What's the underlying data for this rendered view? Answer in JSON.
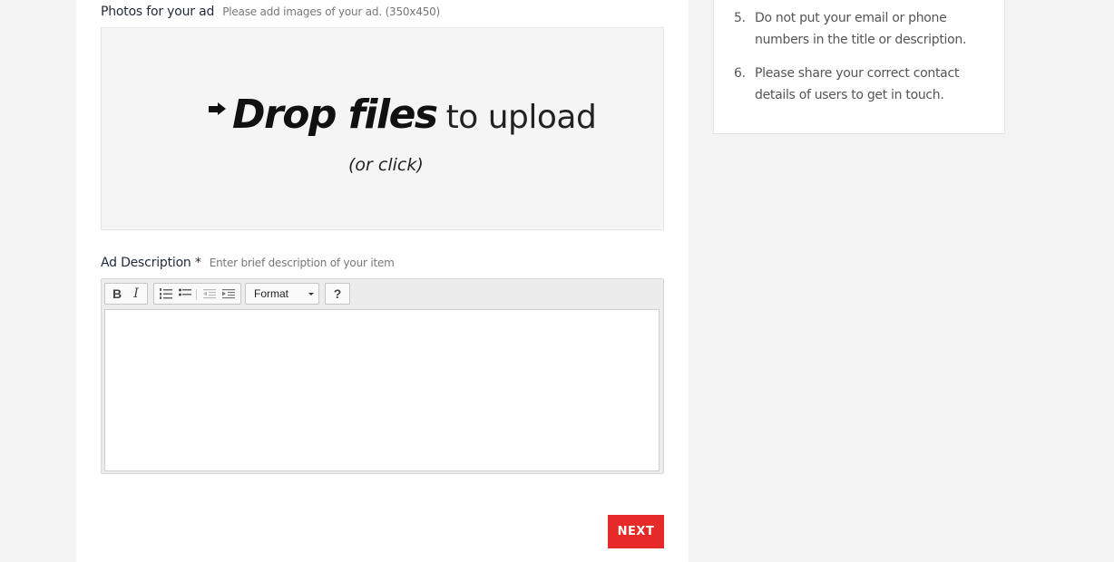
{
  "photos": {
    "label": "Photos for your ad",
    "hint": "Please add images of your ad. (350x450)",
    "dropzone": {
      "bold": "Drop files",
      "rest": "to upload",
      "sub": "(or click)"
    }
  },
  "description": {
    "label": "Ad Description",
    "required_mark": "*",
    "hint": "Enter brief description of your item",
    "toolbar": {
      "bold": "B",
      "italic": "I",
      "format": "Format",
      "help": "?"
    },
    "value": ""
  },
  "next_label": "NEXT",
  "tips": [
    {
      "num": "5.",
      "text": "Do not put your email or phone numbers in the title or description."
    },
    {
      "num": "6.",
      "text": "Please share your correct contact details of users to get in touch."
    }
  ],
  "colors": {
    "accent": "#e52a27",
    "page_bg": "#f3f3f3",
    "dropzone_bg": "#f5f5f5"
  },
  "icons": [
    "arrow-right-icon",
    "numbered-list-icon",
    "bullet-list-icon",
    "outdent-icon",
    "indent-icon",
    "chevron-down-icon",
    "help-icon"
  ]
}
